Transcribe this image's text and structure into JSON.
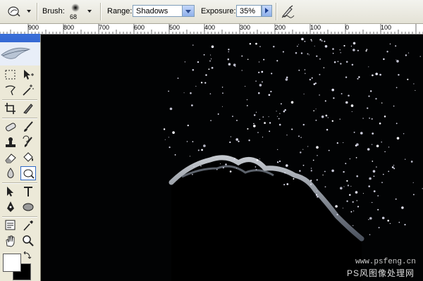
{
  "options_bar": {
    "brush_label": "Brush:",
    "brush_size": "68",
    "range_label": "Range:",
    "range_value": "Shadows",
    "exposure_label": "Exposure:",
    "exposure_value": "35%"
  },
  "ruler": {
    "labels": [
      "900",
      "800",
      "700",
      "600",
      "500",
      "400",
      "300",
      "200",
      "100",
      "0",
      "100"
    ]
  },
  "tools": [
    "marquee-tool",
    "move-tool",
    "lasso-tool",
    "magic-wand-tool",
    "crop-tool",
    "slice-tool",
    "healing-brush-tool",
    "brush-tool",
    "clone-stamp-tool",
    "history-brush-tool",
    "eraser-tool",
    "paint-bucket-tool",
    "blur-tool",
    "dodge-tool",
    "path-selection-tool",
    "type-tool",
    "pen-tool",
    "ellipse-tool",
    "notes-tool",
    "eyedropper-tool",
    "hand-tool",
    "zoom-tool"
  ],
  "active_tool": "dodge-tool",
  "colors": {
    "foreground": "#ffffff",
    "background": "#000000"
  },
  "watermark": {
    "url": "www.psfeng.cn",
    "name": "PS风图像处理网"
  }
}
